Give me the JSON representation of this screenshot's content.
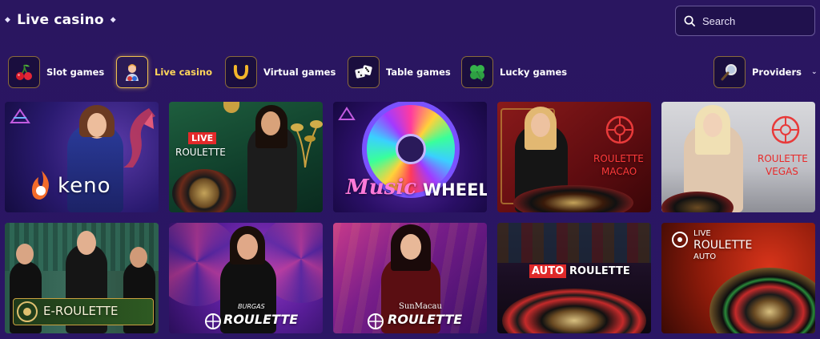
{
  "header": {
    "title": "Live casino",
    "search_placeholder": "Search"
  },
  "categories": [
    {
      "label": "Slot games",
      "icon": "cherry-icon",
      "active": false
    },
    {
      "label": "Live casino",
      "icon": "croupier-icon",
      "active": true
    },
    {
      "label": "Virtual games",
      "icon": "horseshoe-icon",
      "active": false
    },
    {
      "label": "Table games",
      "icon": "dice-icon",
      "active": false
    },
    {
      "label": "Lucky games",
      "icon": "clover-icon",
      "active": false
    }
  ],
  "providers": {
    "label": "Providers",
    "icon": "magnifier-icon"
  },
  "games": [
    {
      "title": "keno"
    },
    {
      "title_top": "LIVE",
      "title": "ROULETTE"
    },
    {
      "title_a": "Music",
      "title_b": "WHEEL"
    },
    {
      "title": "ROULETTE",
      "subtitle": "MACAO"
    },
    {
      "title": "ROULETTE",
      "subtitle": "VEGAS"
    },
    {
      "title": "E-ROULETTE"
    },
    {
      "brand": "BURGAS",
      "title": "ROULETTE"
    },
    {
      "brand": "SunMacau",
      "title": "ROULETTE"
    },
    {
      "title_a": "AUTO",
      "title_b": "ROULETTE"
    },
    {
      "title_top": "LIVE",
      "title": "ROULETTE",
      "subtitle": "AUTO"
    }
  ],
  "colors": {
    "background": "#2a1562",
    "accent_gold": "#f2c14e",
    "active_text": "#ffd65a"
  }
}
